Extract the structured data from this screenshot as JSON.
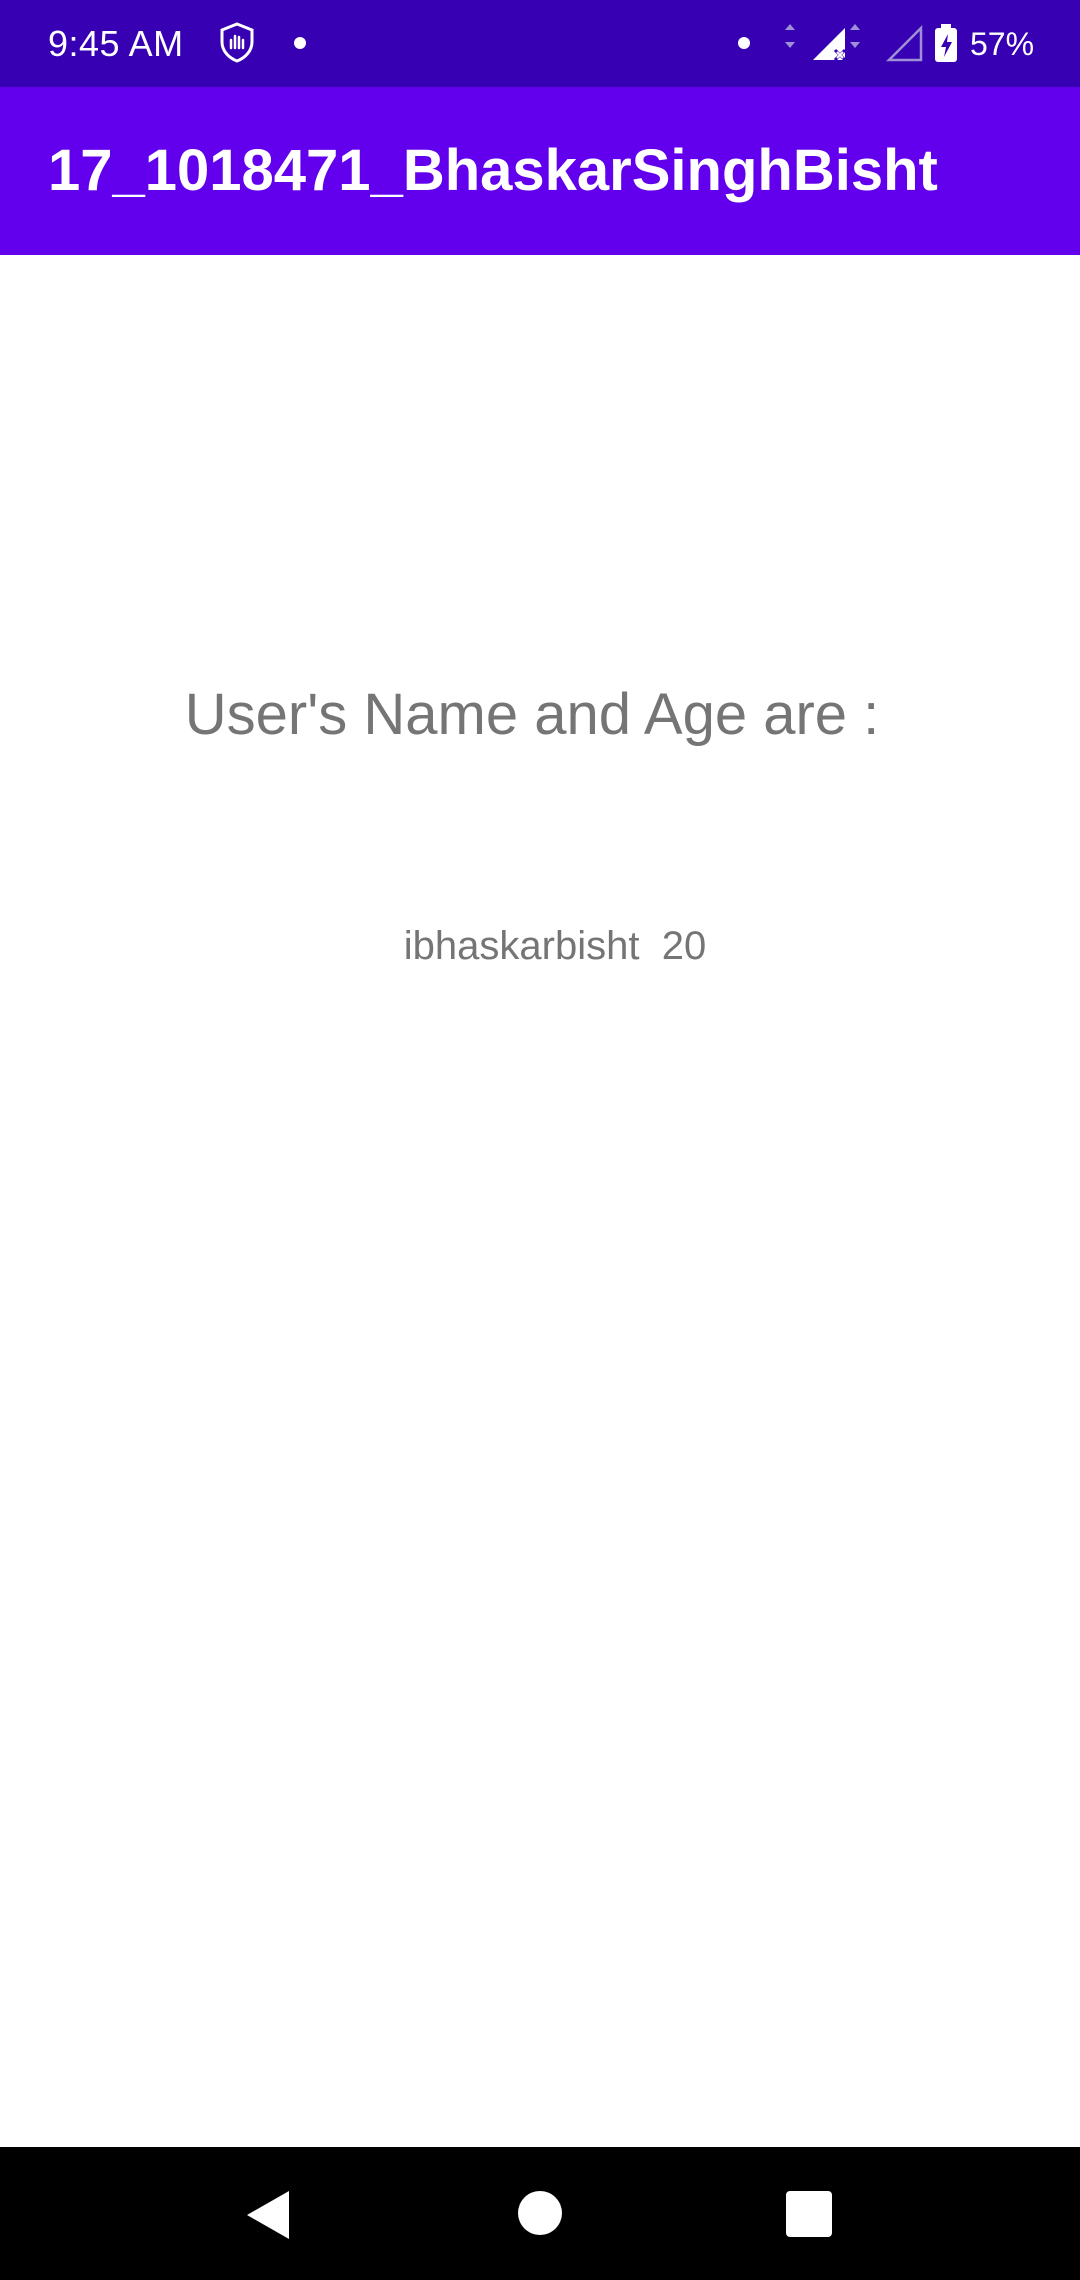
{
  "status_bar": {
    "time": "9:45 AM",
    "battery_percent": "57%",
    "icons": [
      "shield-icon",
      "notification-dot-icon",
      "signal-icon",
      "signal-empty-icon",
      "battery-charging-icon"
    ],
    "background_color": "#3700b3"
  },
  "app_bar": {
    "title": "17_1018471_BhaskarSinghBisht",
    "background_color": "#6200ee"
  },
  "main": {
    "heading": "User's Name and Age are :",
    "user_info": "ibhaskarbisht  20",
    "text_color": "#757575"
  },
  "nav_bar": {
    "buttons": [
      "back-icon",
      "home-icon",
      "recents-icon"
    ],
    "background_color": "#000000"
  }
}
